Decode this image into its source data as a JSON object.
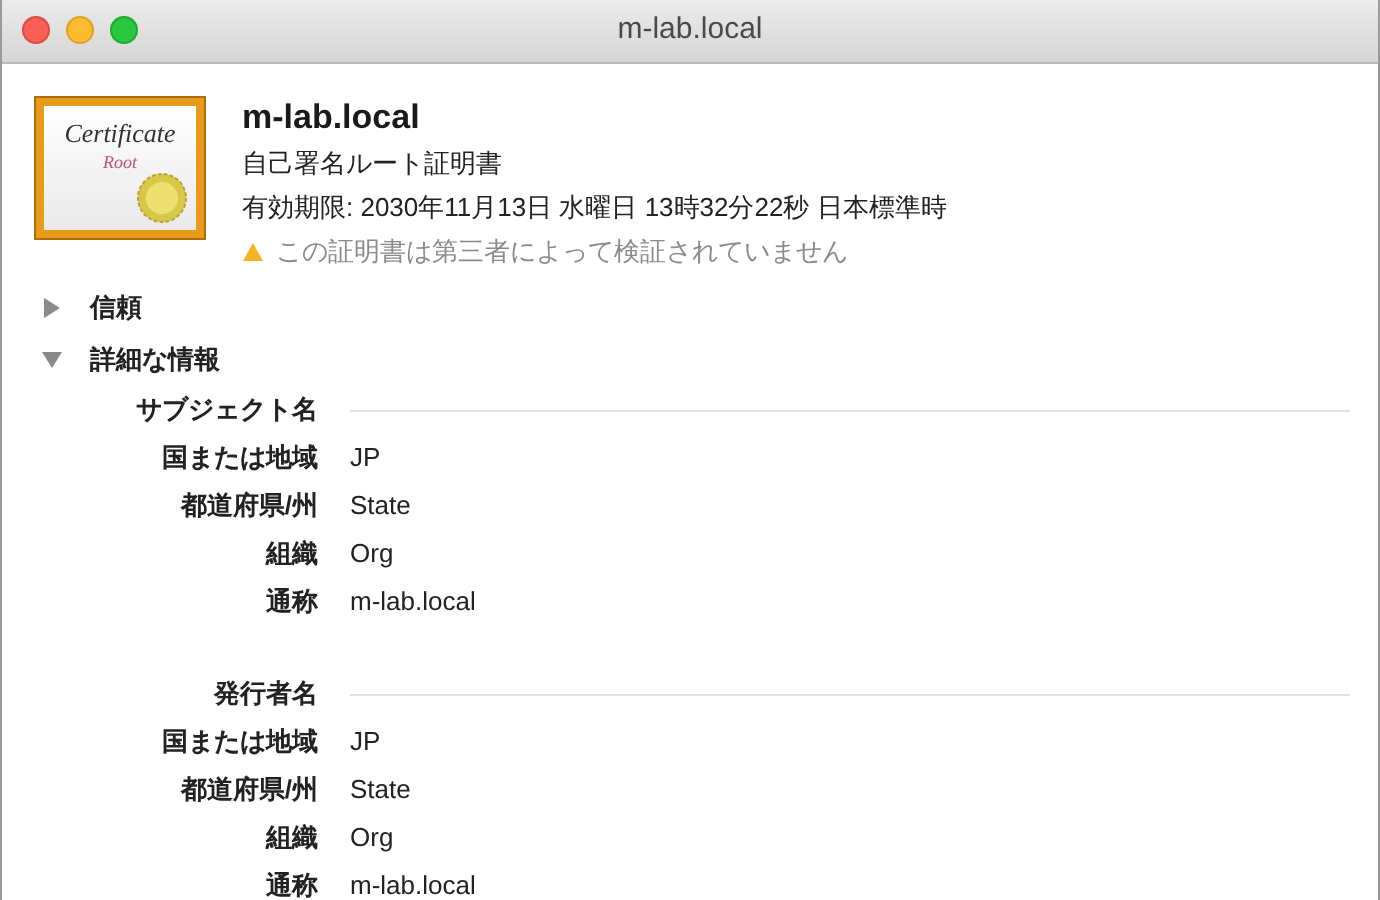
{
  "window": {
    "title": "m-lab.local"
  },
  "certificate": {
    "icon_text": [
      "Certificate",
      "Root"
    ],
    "name": "m-lab.local",
    "type": "自己署名ルート証明書",
    "expires": "有効期限: 2030年11月13日 水曜日 13時32分22秒 日本標準時",
    "warning": "この証明書は第三者によって検証されていません"
  },
  "sections": [
    {
      "label": "信頼",
      "expanded": false
    },
    {
      "label": "詳細な情報",
      "expanded": true,
      "groups": [
        {
          "title": "サブジェクト名",
          "fields": [
            {
              "label": "国または地域",
              "value": "JP"
            },
            {
              "label": "都道府県/州",
              "value": "State"
            },
            {
              "label": "組織",
              "value": "Org"
            },
            {
              "label": "通称",
              "value": "m-lab.local"
            }
          ]
        },
        {
          "title": "発行者名",
          "fields": [
            {
              "label": "国または地域",
              "value": "JP"
            },
            {
              "label": "都道府県/州",
              "value": "State"
            },
            {
              "label": "組織",
              "value": "Org"
            },
            {
              "label": "通称",
              "value": "m-lab.local"
            }
          ]
        }
      ]
    }
  ]
}
